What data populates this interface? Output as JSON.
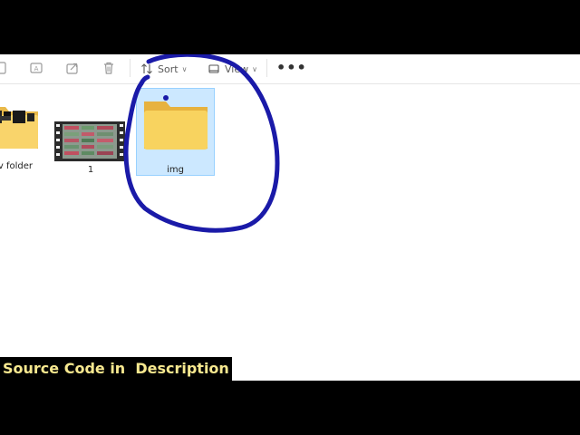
{
  "toolbar": {
    "icons": [
      "copy-icon",
      "rename-icon",
      "share-icon",
      "delete-icon"
    ],
    "sort_label": "Sort",
    "view_label": "View",
    "more_label": "•••"
  },
  "items": [
    {
      "label": "New folder",
      "visible_label": "v folder",
      "type": "folder"
    },
    {
      "label": "1",
      "type": "video"
    },
    {
      "label": "img",
      "type": "folder",
      "selected": true
    }
  ],
  "annotation": {
    "color": "#1a1aa8",
    "shape": "hand-drawn-circle"
  },
  "caption": {
    "text": "Source Code in  Description",
    "color": "#f7e88f"
  }
}
